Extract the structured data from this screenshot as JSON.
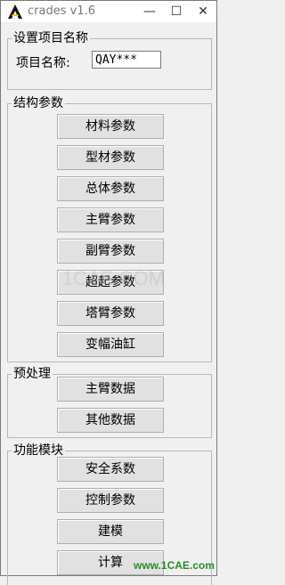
{
  "window": {
    "title": "crades v1.6",
    "min": "—",
    "max": "☐",
    "close": "✕"
  },
  "project": {
    "group_title": "设置项目名称",
    "label": "项目名称:",
    "value": "QAY***"
  },
  "structure": {
    "group_title": "结构参数",
    "buttons": [
      "材料参数",
      "型材参数",
      "总体参数",
      "主臂参数",
      "副臂参数",
      "超起参数",
      "塔臂参数",
      "变幅油缸"
    ]
  },
  "preprocess": {
    "group_title": "预处理",
    "buttons": [
      "主臂数据",
      "其他数据"
    ]
  },
  "modules": {
    "group_title": "功能模块",
    "buttons": [
      "安全系数",
      "控制参数",
      "建模",
      "计算"
    ]
  },
  "watermark": {
    "text": "www.1CAE.com",
    "logo": "1CAE.COM"
  },
  "colors": {
    "watermark": "#2a8c2a",
    "button_bg": "#e1e1e1",
    "window_bg": "#f0f0f0"
  }
}
